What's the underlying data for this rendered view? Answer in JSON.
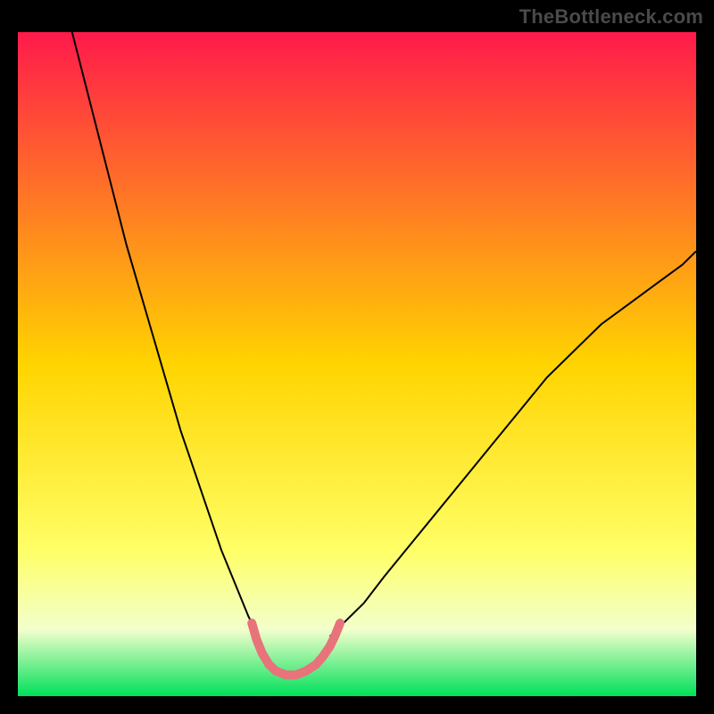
{
  "watermark": "TheBottleneck.com",
  "chart_data": {
    "type": "line",
    "title": "",
    "xlabel": "",
    "ylabel": "",
    "xlim": [
      0,
      100
    ],
    "ylim": [
      0,
      100
    ],
    "grid": false,
    "legend": false,
    "background_gradient": {
      "stops": [
        {
          "offset": 0.0,
          "color": "#ff1a4b"
        },
        {
          "offset": 0.5,
          "color": "#ffd400"
        },
        {
          "offset": 0.78,
          "color": "#ffff66"
        },
        {
          "offset": 0.9,
          "color": "#f2ffcc"
        },
        {
          "offset": 1.0,
          "color": "#00e05a"
        }
      ]
    },
    "series": [
      {
        "name": "left-branch",
        "color": "#000000",
        "width": 2,
        "x": [
          8,
          10,
          12,
          14,
          16,
          18,
          20,
          22,
          24,
          26,
          28,
          30,
          32,
          34,
          35.5
        ],
        "y": [
          100,
          92,
          84,
          76,
          68,
          61,
          54,
          47,
          40,
          34,
          28,
          22,
          17,
          12,
          9
        ]
      },
      {
        "name": "right-branch",
        "color": "#000000",
        "width": 2,
        "x": [
          46,
          48,
          51,
          54,
          58,
          62,
          66,
          70,
          74,
          78,
          82,
          86,
          90,
          94,
          98,
          100
        ],
        "y": [
          9,
          11,
          14,
          18,
          23,
          28,
          33,
          38,
          43,
          48,
          52,
          56,
          59,
          62,
          65,
          67
        ]
      },
      {
        "name": "valley-highlight",
        "color": "#e8737b",
        "width": 10,
        "linecap": "round",
        "x": [
          34.5,
          35.2,
          36.0,
          37.0,
          38.0,
          39.5,
          41.0,
          42.5,
          44.0,
          45.0,
          46.0,
          46.8,
          47.5
        ],
        "y": [
          11.0,
          8.5,
          6.5,
          4.8,
          3.8,
          3.2,
          3.2,
          3.8,
          4.8,
          6.0,
          7.5,
          9.2,
          11.0
        ]
      }
    ]
  }
}
